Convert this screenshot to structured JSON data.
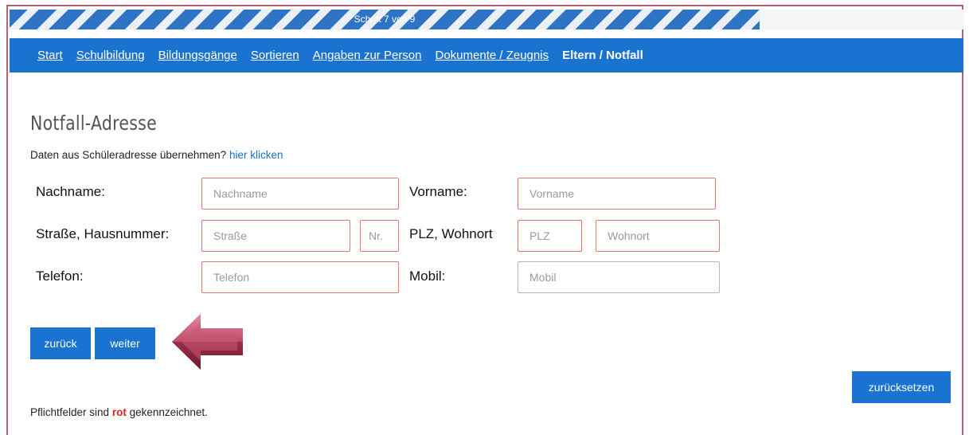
{
  "progress": {
    "label": "Schritt 7 von 9",
    "current": 7,
    "total": 9
  },
  "nav": {
    "items": [
      {
        "label": "Start"
      },
      {
        "label": "Schulbildung"
      },
      {
        "label": "Bildungsgänge"
      },
      {
        "label": "Sortieren"
      },
      {
        "label": "Angaben zur Person"
      },
      {
        "label": "Dokumente / Zeugnis"
      },
      {
        "label": "Eltern / Notfall",
        "active": true
      }
    ]
  },
  "page": {
    "title": "Notfall-Adresse",
    "copy_prompt": "Daten aus Schüleradresse übernehmen?",
    "copy_link": "hier klicken"
  },
  "form": {
    "lastname": {
      "label": "Nachname:",
      "placeholder": "Nachname",
      "value": ""
    },
    "firstname": {
      "label": "Vorname:",
      "placeholder": "Vorname",
      "value": ""
    },
    "street_label": "Straße, Hausnummer:",
    "street": {
      "placeholder": "Straße",
      "value": ""
    },
    "housenumber": {
      "placeholder": "Nr.",
      "value": ""
    },
    "city_label": "PLZ, Wohnort",
    "zip": {
      "placeholder": "PLZ",
      "value": ""
    },
    "city": {
      "placeholder": "Wohnort",
      "value": ""
    },
    "phone": {
      "label": "Telefon:",
      "placeholder": "Telefon",
      "value": ""
    },
    "mobile": {
      "label": "Mobil:",
      "placeholder": "Mobil",
      "value": ""
    }
  },
  "buttons": {
    "back": "zurück",
    "next": "weiter",
    "reset": "zurücksetzen"
  },
  "footnote": {
    "prefix": "Pflichtfelder sind",
    "highlight": "rot",
    "suffix": "gekennzeichnet."
  },
  "icons": {
    "pointer": "arrow-left-icon"
  },
  "colors": {
    "accent": "#1a73d1",
    "required_border": "#e8736f",
    "optional_border": "#b7b7b7",
    "arrow": "#b4455e",
    "frame": "#b8607a",
    "required_text": "#d9261c"
  }
}
